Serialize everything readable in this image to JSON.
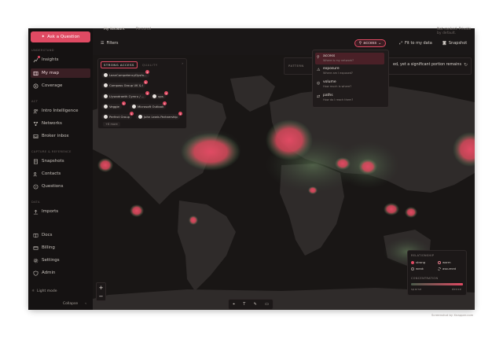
{
  "sidebar": {
    "ask_label": "Ask a Question",
    "sections": {
      "understand": "UNDERSTAND",
      "act": "ACT",
      "capture": "CAPTURE & REFERENCE",
      "data": "DATA"
    },
    "items": {
      "insights": "Insights",
      "mymap": "My map",
      "coverage": "Coverage",
      "intro": "Intro Intelligence",
      "networks": "Networks",
      "broker": "Broker inbox",
      "snapshots": "Snapshots",
      "contacts": "Contacts",
      "questions": "Questions",
      "imports": "Imports",
      "docs": "Docs",
      "billing": "Billing",
      "settings": "Settings",
      "admin": "Admin"
    },
    "light_mode": "Light mode",
    "collapse": "Collapse"
  },
  "toolbar": {
    "title": "My Network",
    "subtitle": "Personal",
    "right_note": "Not ranked. Private by default.",
    "filters": "Filters",
    "access": "access",
    "fit": "Fit to my data",
    "snapshot": "Snapshot"
  },
  "panel": {
    "tab_strong": "STRONG ACCESS",
    "tab_quality": "QUALITY",
    "chips": [
      {
        "label": "LeanCompetencyDysfa...",
        "badge": "1"
      },
      {
        "label": "Compass Group UK & I",
        "badge": "1"
      },
      {
        "label": "Llywodraeth Cymru / ...",
        "badge": "1"
      },
      {
        "label": "ups",
        "badge": "1"
      },
      {
        "label": "Veggie",
        "badge": "1"
      },
      {
        "label": "Microsoft Outlook",
        "badge": "1"
      },
      {
        "label": "Perfect Group",
        "badge": "1"
      },
      {
        "label": "John Lewis Partnership",
        "badge": "1"
      }
    ],
    "more": "+6 more"
  },
  "dropdown": {
    "items": [
      {
        "title": "access",
        "sub": "Where is my network?",
        "icon": "⚲"
      },
      {
        "title": "exposure",
        "sub": "Where am I exposed?",
        "icon": "⚠"
      },
      {
        "title": "volume",
        "sub": "How much is where?",
        "icon": "◎"
      },
      {
        "title": "paths",
        "sub": "How do I reach them?",
        "icon": "⇄"
      }
    ]
  },
  "pattern_label": "PATTERN",
  "banner_text": "ed, yet a significant portion remains",
  "legend": {
    "rel_header": "RELATIONSHIP",
    "strong": "strong",
    "warm": "warm",
    "weak": "weak",
    "assumed": "assumed",
    "conc_header": "CONCENTRATION",
    "sparse": "sparse",
    "dense": "dense"
  },
  "footer": "Screenshot by Xnapper.com",
  "colors": {
    "accent": "#e04a63",
    "bg": "#1a1717",
    "land": "#2f2b2a",
    "ocean": "#1a1716"
  }
}
